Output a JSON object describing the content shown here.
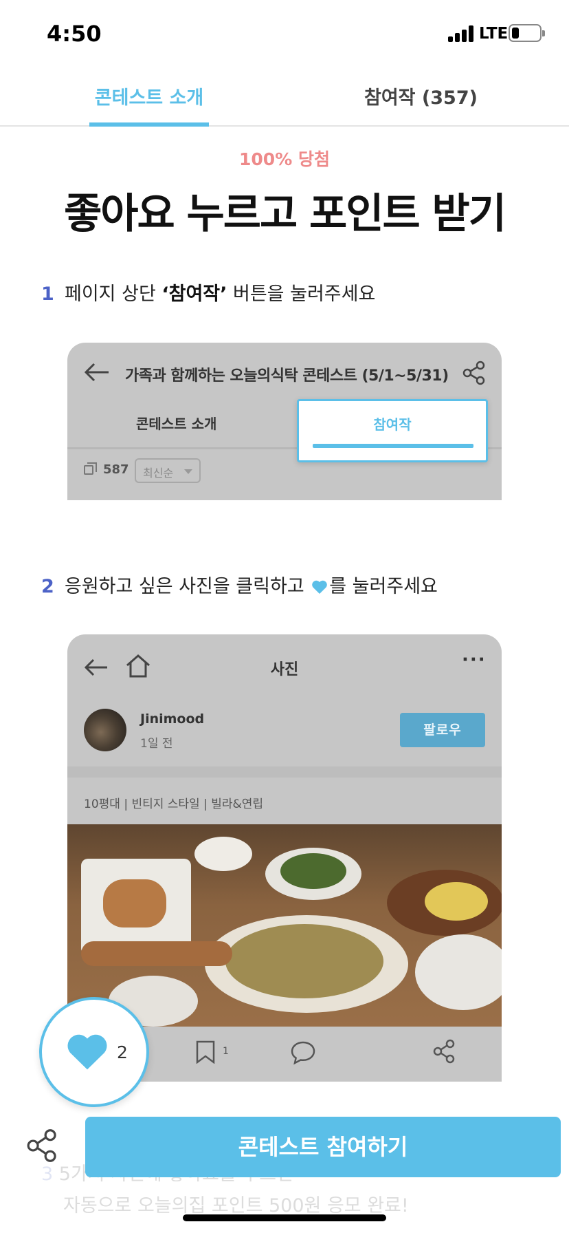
{
  "status_bar": {
    "time": "4:50",
    "network": "LTE"
  },
  "tabs": [
    {
      "label": "콘테스트 소개",
      "active": true
    },
    {
      "label": "참여작 (357)",
      "active": false
    }
  ],
  "hero": {
    "badge": "100% 당첨",
    "headline": "좋아요 누르고 포인트 받기"
  },
  "step1": {
    "num": "1",
    "text_before": "페이지 상단 ",
    "text_bold": "‘참여작’",
    "text_after": " 버튼을 눌러주세요",
    "panel": {
      "title": "가족과 함께하는 오늘의식탁 콘테스트 (5/1~5/31)",
      "tab_intro": "콘테스트 소개",
      "tab_entries": "참여작",
      "count": "587",
      "sort": "최신순"
    }
  },
  "step2": {
    "num": "2",
    "text_before": "응원하고 싶은 사진을 클릭하고 ",
    "text_after": "를 눌러주세요",
    "panel": {
      "title": "사진",
      "more": "···",
      "user": "Jinimood",
      "time": "1일 전",
      "follow": "팔로우",
      "tags": "10평대 | 빈티지 스타일 | 빌라&연립",
      "bookmark_count": "1"
    }
  },
  "like": {
    "count": "2"
  },
  "step3": {
    "num": "3",
    "line1": "5가지 사진에 좋아요를 누르면",
    "line2": "자동으로 오늘의집 포인트 500원 응모 완료!"
  },
  "cta": {
    "label": "콘테스트 참여하기"
  },
  "colors": {
    "accent": "#5bbfe8",
    "badge": "#ee8a8a",
    "step_num": "#4c62c7"
  }
}
